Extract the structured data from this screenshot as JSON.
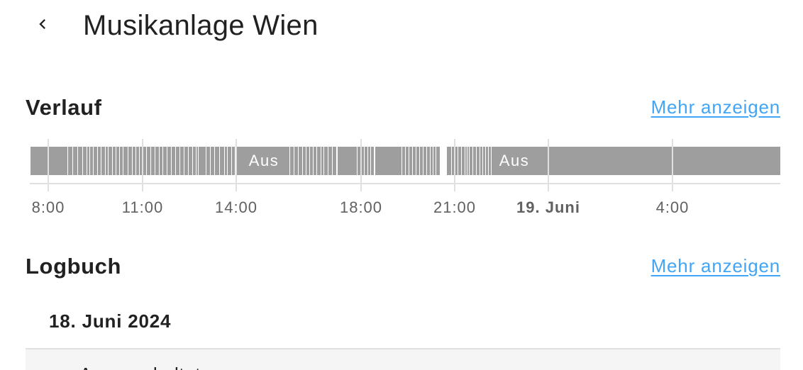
{
  "header": {
    "title": "Musikanlage Wien",
    "back_icon": "chevron-left-icon"
  },
  "history": {
    "title": "Verlauf",
    "more_label": "Mehr anzeigen",
    "state_label": "Aus",
    "bar_color": "#9e9e9e",
    "ticks": [
      "8:00",
      "11:00",
      "14:00",
      "18:00",
      "21:00",
      "19. Juni",
      "4:00"
    ]
  },
  "logbook": {
    "title": "Logbuch",
    "more_label": "Mehr anzeigen",
    "date": "18. Juni 2024",
    "entry_text": "Ausgeschaltet"
  },
  "colors": {
    "link": "#42a5f5",
    "text": "#212121",
    "muted": "#616161",
    "divider": "#e0e0e0",
    "row_bg": "#f5f5f5"
  }
}
